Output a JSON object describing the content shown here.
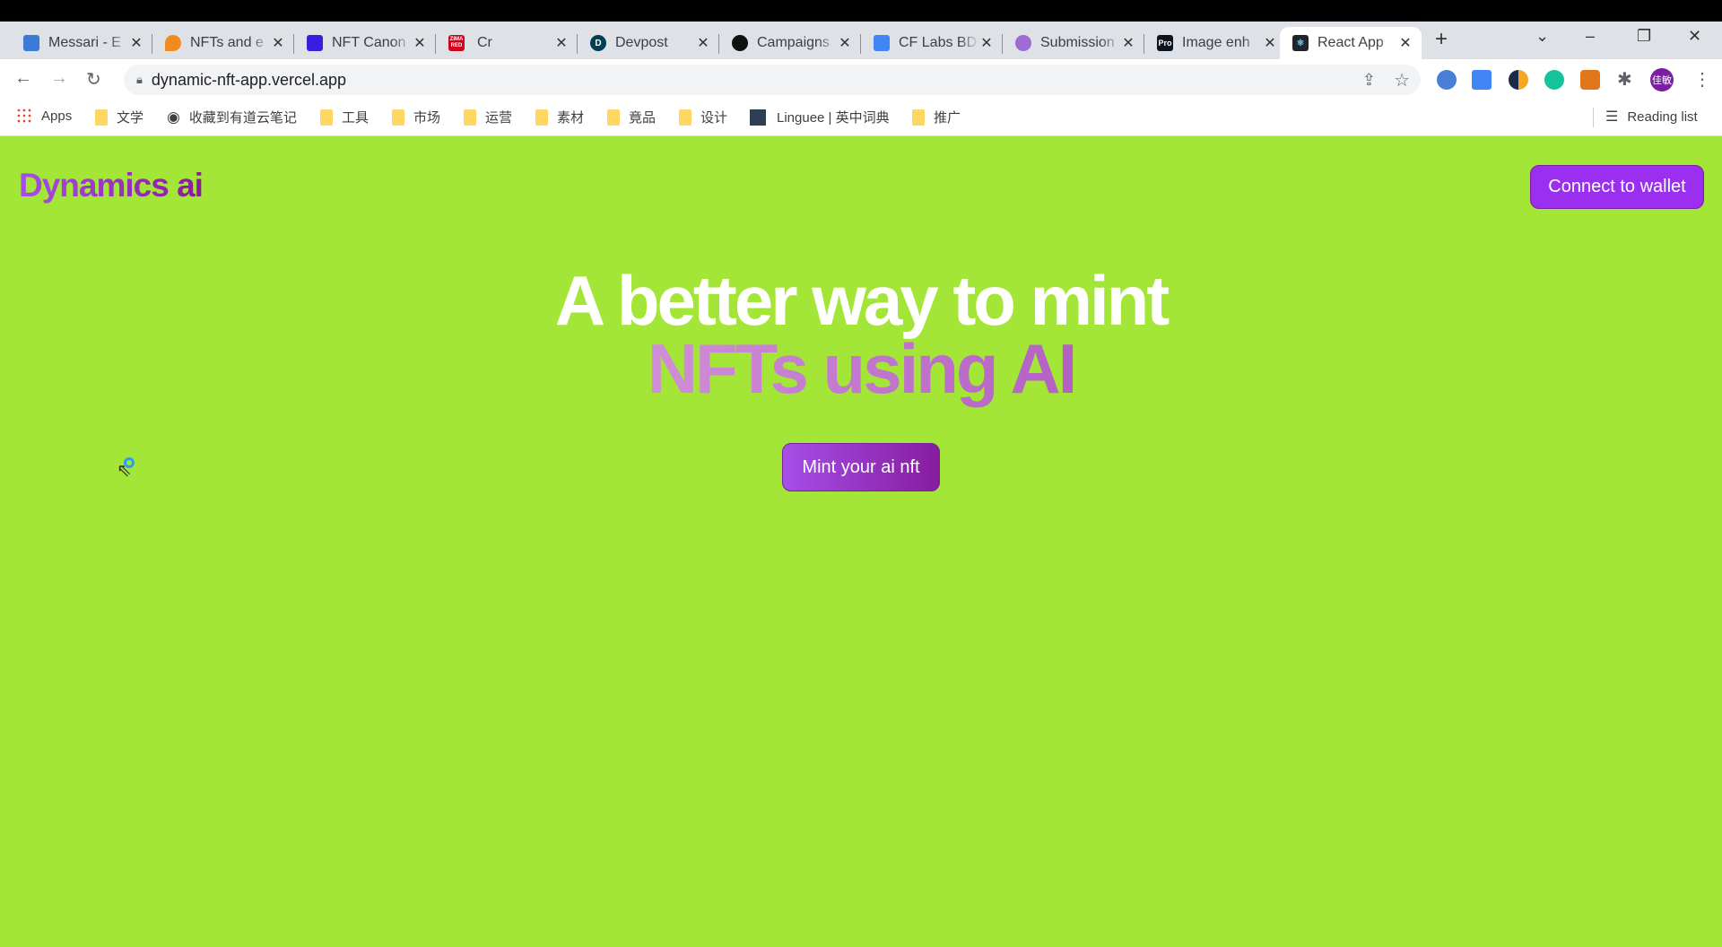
{
  "browser": {
    "tabs": [
      {
        "title": "Messari - E",
        "favicon_color": "#3a7bd5"
      },
      {
        "title": "NFTs and e",
        "favicon_color": "#f28b1e"
      },
      {
        "title": "NFT Canon",
        "favicon_color": "#3b1de0"
      },
      {
        "title": "Cr",
        "favicon_color": "#d0021b",
        "favicon_text": "ZIMA RED"
      },
      {
        "title": "Devpost",
        "favicon_color": "#003e54",
        "favicon_text": "D"
      },
      {
        "title": "Campaigns",
        "favicon_color": "#111111"
      },
      {
        "title": "CF Labs BD",
        "favicon_color": "#4285f4"
      },
      {
        "title": "Submission",
        "favicon_color": "#9c6bd6"
      },
      {
        "title": "Image enh",
        "favicon_color": "#0b1420",
        "favicon_text": "Pro"
      },
      {
        "title": "React App",
        "favicon_color": "#20232a",
        "active": true
      }
    ],
    "url": "dynamic-nft-app.vercel.app",
    "profile_text": "佳敏",
    "bookmarks": [
      "Apps",
      "文学",
      "收藏到有道云笔记",
      "工具",
      "市场",
      "运营",
      "素材",
      "竟品",
      "设计",
      "Linguee | 英中词典",
      "推广"
    ],
    "reading_list": "Reading list"
  },
  "page": {
    "logo": "Dynamics ai",
    "connect_button": "Connect to wallet",
    "headline_line1": "A better way to mint",
    "headline_line2": "NFTs using AI",
    "mint_button": "Mint your ai nft",
    "colors": {
      "background": "#a4e637",
      "accent": "#9b2ff0"
    }
  }
}
